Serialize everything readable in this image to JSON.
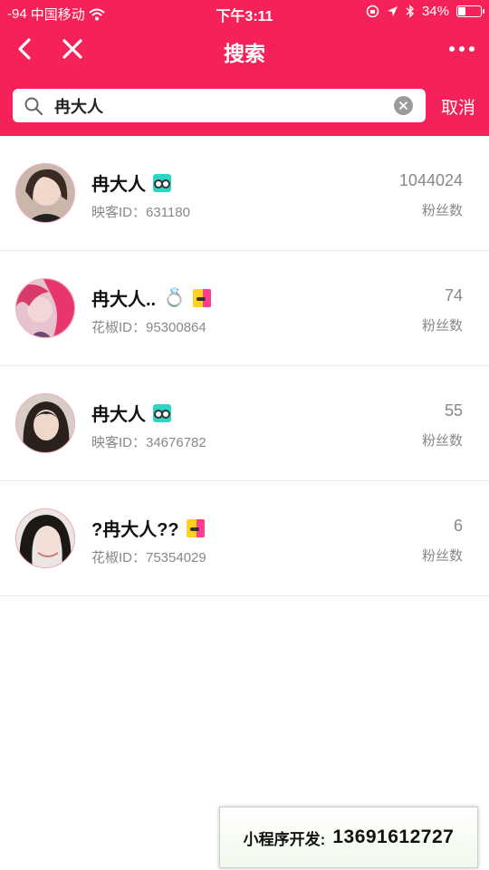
{
  "status_bar": {
    "signal": "-94",
    "carrier": "中国移动",
    "time": "下午3:11",
    "battery": "34%",
    "battery_level": 0.34
  },
  "nav": {
    "title": "搜索",
    "back_icon": "chevron-left-icon",
    "close_icon": "close-icon",
    "more_icon": "more-icon"
  },
  "search": {
    "value": "冉大人",
    "cancel_label": "取消"
  },
  "results": [
    {
      "name": "冉大人",
      "extra": "",
      "badge": "inke",
      "uid": "映客ID：631180",
      "count": "1044024",
      "count_label": "粉丝数"
    },
    {
      "name": "冉大人..",
      "extra": "💍",
      "badge": "huajiao",
      "uid": "花椒ID：95300864",
      "count": "74",
      "count_label": "粉丝数"
    },
    {
      "name": "冉大人",
      "extra": "",
      "badge": "inke",
      "uid": "映客ID：34676782",
      "count": "55",
      "count_label": "粉丝数"
    },
    {
      "name": "?冉大人??",
      "extra": "",
      "badge": "huajiao",
      "uid": "花椒ID：75354029",
      "count": "6",
      "count_label": "粉丝数"
    }
  ],
  "footer": {
    "label": "小程序开发:",
    "phone": "13691612727"
  },
  "colors": {
    "accent": "#f5225a"
  }
}
